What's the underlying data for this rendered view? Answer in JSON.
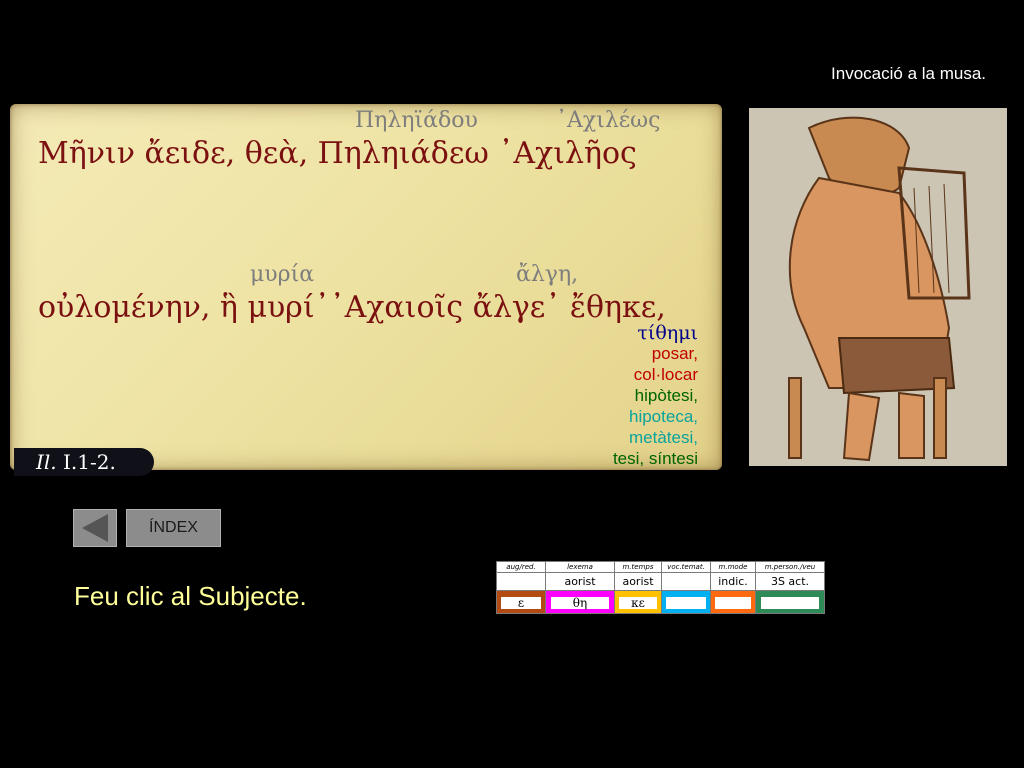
{
  "slide_title": "Invocació a la musa.",
  "text": {
    "line1": "Μῆνιν ἄειδε, θεὰ, Πηληιάδεω ᾿Αχιλῆος",
    "line2": "οὐλομένην, ἣ μυρί᾿᾿Αχαιοῖς ἄλγε᾿ ἔθηκε,",
    "gloss_line1": [
      "Πηληϊάδου",
      "᾿Αχιλέως"
    ],
    "gloss_line2": [
      "μυρία",
      "ἄλγη,"
    ],
    "reference_abbr": "Il.",
    "reference_loc": "I.1-2."
  },
  "lemma": "τίθημι",
  "derived_words": [
    "posar,",
    "col·locar",
    "hipòtesi,",
    "hipoteca,",
    "metàtesi,",
    "tesi, síntesi"
  ],
  "nav": {
    "back_icon": "triangle-left-icon",
    "index_label": "ÍNDEX"
  },
  "prompt": "Feu clic al Subjecte.",
  "morph_table": {
    "headers": [
      "aug/red.",
      "lexema",
      "m.temps",
      "voc.temat.",
      "m.mode",
      "m.person./veu"
    ],
    "values": [
      "",
      "aorist",
      "aorist",
      "",
      "indic.",
      "3S act."
    ],
    "chips": [
      {
        "text": "ε",
        "color": "#b34a12"
      },
      {
        "text": "θη",
        "color": "#ff00ff"
      },
      {
        "text": "κε",
        "color": "#ffc000"
      },
      {
        "text": "",
        "color": "#00b0f0"
      },
      {
        "text": "",
        "color": "#ff6a10"
      },
      {
        "text": "",
        "color": "#2e8b57"
      }
    ]
  },
  "colors": {
    "greek_text": "#7a1010",
    "gloss": "#7d7d7d",
    "prompt": "#ffff99",
    "lemma": "#00008b"
  },
  "image": {
    "subject": "lyre-player-vase-painting"
  }
}
